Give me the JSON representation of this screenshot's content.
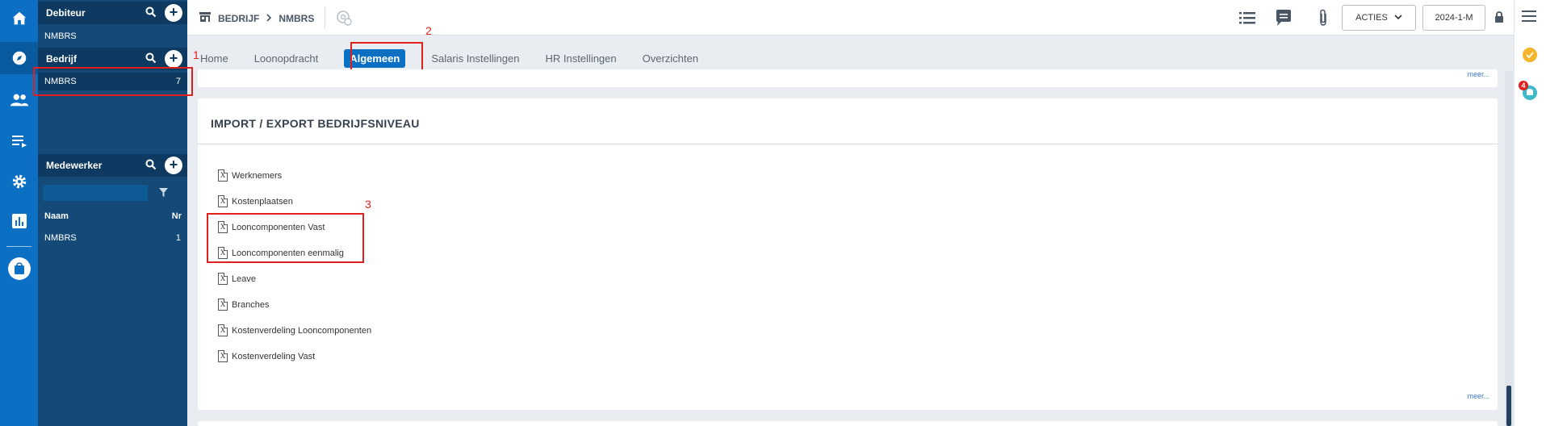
{
  "rail": {
    "icons": [
      "home-icon",
      "compass-icon",
      "users-icon",
      "list-icon",
      "gear-icon",
      "chart-icon",
      "bag-icon"
    ]
  },
  "panel": {
    "debiteur": {
      "title": "Debiteur",
      "item": "NMBRS"
    },
    "bedrijf": {
      "title": "Bedrijf",
      "item": "NMBRS",
      "count": "7"
    },
    "medewerker": {
      "title": "Medewerker",
      "col_name": "Naam",
      "col_nr": "Nr",
      "row_name": "NMBRS",
      "row_nr": "1"
    }
  },
  "annotations": {
    "one": "1",
    "two": "2",
    "three": "3"
  },
  "topbar": {
    "crumb1": "BEDRIJF",
    "crumb2": "NMBRS",
    "acties": "ACTIES",
    "period": "2024-1-M"
  },
  "tabs": [
    "Home",
    "Loonopdracht",
    "Algemeen",
    "Salaris Instellingen",
    "HR Instellingen",
    "Overzichten"
  ],
  "card_top": {
    "more": "meer..."
  },
  "card": {
    "title": "IMPORT / EXPORT BEDRIJFSNIVEAU",
    "more": "meer...",
    "links": [
      "Werknemers",
      "Kostenplaatsen",
      "Looncomponenten Vast",
      "Looncomponenten eenmalig",
      "Leave",
      "Branches",
      "Kostenverdeling Looncomponenten",
      "Kostenverdeling Vast"
    ]
  },
  "right": {
    "badge": "4"
  },
  "colors": {
    "rail": "#0b6fc4",
    "panel": "#154a78",
    "accent": "#0b6fc4",
    "annotation": "#e0201c",
    "check": "#f5b52a",
    "bell": "#3fb8c9"
  }
}
